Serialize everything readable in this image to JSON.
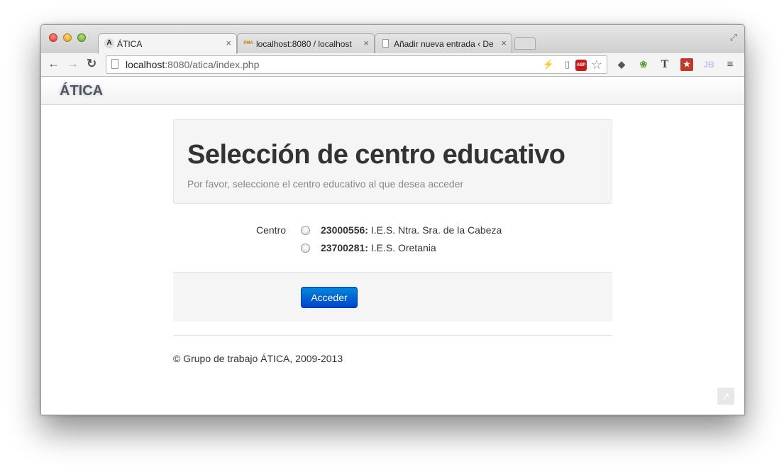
{
  "browser": {
    "tabs": [
      {
        "favicon": "A",
        "title": "ÁTICA",
        "close": "×"
      },
      {
        "favicon": "PMA",
        "title": "localhost:8080 / localhost",
        "close": "×"
      },
      {
        "favicon": "",
        "title": "Añadir nueva entrada ‹ Des",
        "close": "×"
      }
    ],
    "url_host": "localhost",
    "url_rest": ":8080/atica/index.php",
    "extensions": [
      "ABP",
      "T",
      "JB"
    ]
  },
  "navbar": {
    "brand": "ÁTICA"
  },
  "hero": {
    "title": "Selección de centro educativo",
    "subtitle": "Por favor, seleccione el centro educativo al que desea acceder"
  },
  "form": {
    "label": "Centro",
    "options": [
      {
        "code": "23000556:",
        "name": " I.E.S. Ntra. Sra. de la Cabeza"
      },
      {
        "code": "23700281:",
        "name": " I.E.S. Oretania"
      }
    ],
    "submit_label": "Acceder"
  },
  "footer": {
    "text": "© Grupo de trabajo ÁTICA, 2009-2013"
  }
}
